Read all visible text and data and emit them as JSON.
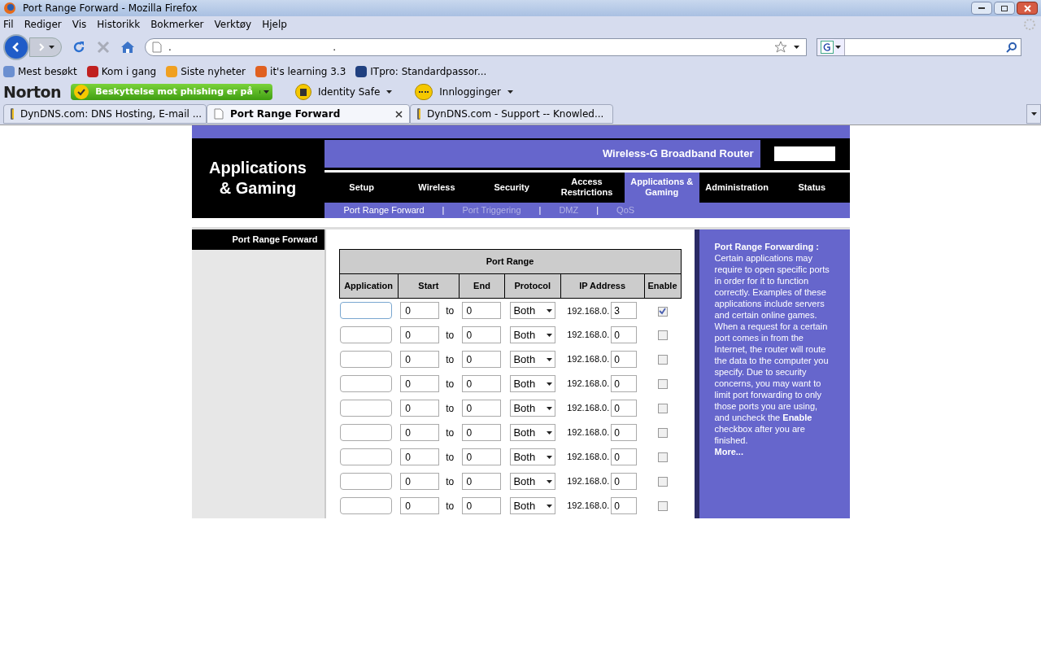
{
  "window": {
    "title": "Port Range Forward - Mozilla Firefox"
  },
  "menu": [
    "Fil",
    "Rediger",
    "Vis",
    "Historikk",
    "Bokmerker",
    "Verktøy",
    "Hjelp"
  ],
  "address_bar": {
    "value": ".                                                    ."
  },
  "bookmarks": [
    "Mest besøkt",
    "Kom i gang",
    "Siste nyheter",
    "it's learning 3.3",
    "ITpro: Standardpassor..."
  ],
  "norton": {
    "brand": "Norton",
    "phishing": "Beskyttelse mot phishing er på",
    "identity": "Identity Safe",
    "logins": "Innlogginger"
  },
  "tabs": [
    {
      "label": "DynDNS.com: DNS Hosting, E-mail ...",
      "selected": false
    },
    {
      "label": "Port Range Forward",
      "selected": true
    },
    {
      "label": "DynDNS.com - Support -- Knowled...",
      "selected": false
    }
  ],
  "router": {
    "section_title": "Applications & Gaming",
    "product": "Wireless-G Broadband Router",
    "nav": [
      {
        "label": "Setup",
        "selected": false
      },
      {
        "label": "Wireless",
        "selected": false
      },
      {
        "label": "Security",
        "selected": false
      },
      {
        "label": "Access Restrictions",
        "selected": false
      },
      {
        "label": "Applications & Gaming",
        "selected": true
      },
      {
        "label": "Administration",
        "selected": false
      },
      {
        "label": "Status",
        "selected": false
      }
    ],
    "subnav": [
      {
        "label": "Port Range Forward",
        "selected": true
      },
      {
        "label": "Port Triggering",
        "selected": false
      },
      {
        "label": "DMZ",
        "selected": false
      },
      {
        "label": "QoS",
        "selected": false
      }
    ],
    "subnav_separator": "|",
    "sidebar_label": "Port Range Forward",
    "table": {
      "title": "Port Range",
      "columns": [
        "Application",
        "Start",
        "End",
        "Protocol",
        "IP Address",
        "Enable"
      ],
      "rows": [
        {
          "application": "",
          "start": "0",
          "sep": "to",
          "end": "0",
          "protocol": "Both",
          "ip_prefix": "192.168.0.",
          "ip": "3",
          "enabled": true
        },
        {
          "application": "",
          "start": "0",
          "sep": "to",
          "end": "0",
          "protocol": "Both",
          "ip_prefix": "192.168.0.",
          "ip": "0",
          "enabled": false
        },
        {
          "application": "",
          "start": "0",
          "sep": "to",
          "end": "0",
          "protocol": "Both",
          "ip_prefix": "192.168.0.",
          "ip": "0",
          "enabled": false
        },
        {
          "application": "",
          "start": "0",
          "sep": "to",
          "end": "0",
          "protocol": "Both",
          "ip_prefix": "192.168.0.",
          "ip": "0",
          "enabled": false
        },
        {
          "application": "",
          "start": "0",
          "sep": "to",
          "end": "0",
          "protocol": "Both",
          "ip_prefix": "192.168.0.",
          "ip": "0",
          "enabled": false
        },
        {
          "application": "",
          "start": "0",
          "sep": "to",
          "end": "0",
          "protocol": "Both",
          "ip_prefix": "192.168.0.",
          "ip": "0",
          "enabled": false
        },
        {
          "application": "",
          "start": "0",
          "sep": "to",
          "end": "0",
          "protocol": "Both",
          "ip_prefix": "192.168.0.",
          "ip": "0",
          "enabled": false
        },
        {
          "application": "",
          "start": "0",
          "sep": "to",
          "end": "0",
          "protocol": "Both",
          "ip_prefix": "192.168.0.",
          "ip": "0",
          "enabled": false
        },
        {
          "application": "",
          "start": "0",
          "sep": "to",
          "end": "0",
          "protocol": "Both",
          "ip_prefix": "192.168.0.",
          "ip": "0",
          "enabled": false
        }
      ]
    },
    "help": {
      "title": "Port Range Forwarding :",
      "text": "Certain applications may require to open specific ports in order for it to function correctly. Examples of these applications include servers and certain online games. When a request for a certain port comes in from the Internet, the router will route the data to the computer you specify. Due to security concerns, you may want to limit port forwarding to only those ports you are using, and uncheck the **Enable** checkbox after you are finished.",
      "more": "More..."
    }
  }
}
